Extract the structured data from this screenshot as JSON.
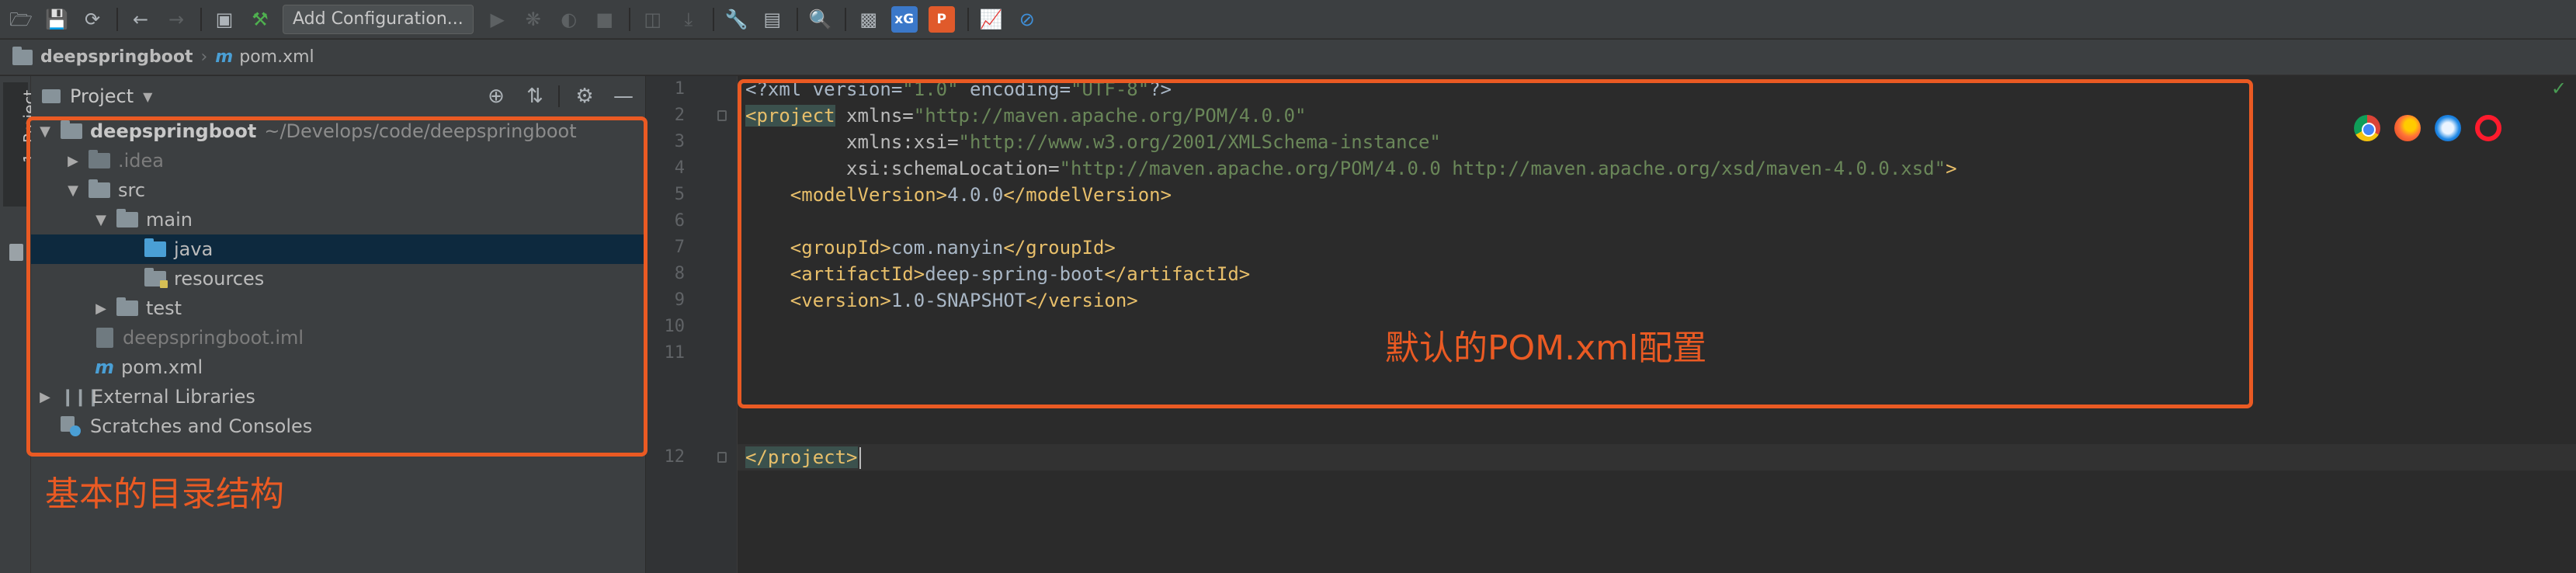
{
  "toolbar": {
    "run_config_label": "Add Configuration...",
    "icons": [
      "open-folder",
      "save",
      "sync",
      "back",
      "forward",
      "project-structure",
      "build-hammer",
      "run",
      "debug",
      "coverage",
      "stop",
      "attach",
      "deploy",
      "wrench",
      "project-settings",
      "search",
      "terminal-window",
      "xdoclet-badge",
      "office-badge",
      "chart",
      "no-entry"
    ],
    "badge_labels": {
      "blue": "xG",
      "red": "P"
    }
  },
  "breadcrumb": {
    "project": "deepspringboot",
    "file": "pom.xml",
    "file_icon_letter": "m"
  },
  "tool_stripe": {
    "label": "1: Project"
  },
  "project_panel": {
    "title": "Project",
    "tree": {
      "root_name": "deepspringboot",
      "root_path": "~/Develops/code/deepspringboot",
      "idea": ".idea",
      "src": "src",
      "main": "main",
      "java": "java",
      "resources": "resources",
      "test": "test",
      "iml": "deepspringboot.iml",
      "pom": "pom.xml",
      "pom_icon_letter": "m",
      "libraries": "External Libraries",
      "scratches": "Scratches and Consoles"
    }
  },
  "editor": {
    "line_numbers": [
      "1",
      "2",
      "3",
      "4",
      "5",
      "6",
      "7",
      "8",
      "9",
      "10",
      "11",
      "12"
    ],
    "code": {
      "l1_a": "<?xml version=",
      "l1_b": "\"1.0\"",
      "l1_c": " encoding=",
      "l1_d": "\"UTF-8\"",
      "l1_e": "?>",
      "l2_a": "<project",
      "l2_b": " xmlns=",
      "l2_c": "\"http://maven.apache.org/POM/4.0.0\"",
      "l3_a": "         xmlns:xsi=",
      "l3_b": "\"http://www.w3.org/2001/XMLSchema-instance\"",
      "l4_a": "         xsi:schemaLocation=",
      "l4_b": "\"http://maven.apache.org/POM/4.0.0 http://maven.apache.org/xsd/maven-4.0.0.xsd\"",
      "l4_c": ">",
      "l5_a": "    <modelVersion>",
      "l5_b": "4.0.0",
      "l5_c": "</modelVersion>",
      "l7_a": "    <groupId>",
      "l7_b": "com.nanyin",
      "l7_c": "</groupId>",
      "l8_a": "    <artifactId>",
      "l8_b": "deep-spring-boot",
      "l8_c": "</artifactId>",
      "l9_a": "    <version>",
      "l9_b": "1.0-SNAPSHOT",
      "l9_c": "</version>",
      "l12_a": "</project>"
    },
    "browser_icons": [
      "chrome",
      "firefox",
      "safari",
      "opera"
    ],
    "status_check": "✓"
  },
  "annotations": {
    "left": "基本的目录结构",
    "right": "默认的POM.xml配置",
    "color": "#ea5a23"
  }
}
